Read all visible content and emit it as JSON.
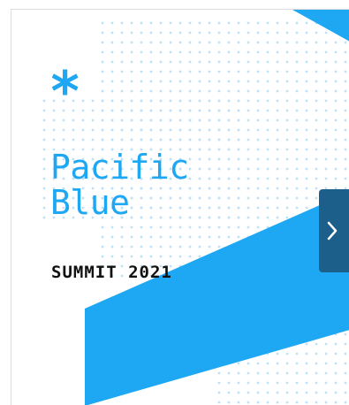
{
  "card": {
    "asterisk": "*",
    "title_line_1": "Pacific",
    "title_line_2": "Blue",
    "subtitle": "SUMMIT 2021"
  },
  "carousel": {
    "next_icon": "chevron-right-icon"
  },
  "colors": {
    "brand_blue": "#1ea7f2",
    "dot_blue": "#bfe1f7",
    "button_blue": "#1d5f8b",
    "text_dark": "#111111"
  }
}
